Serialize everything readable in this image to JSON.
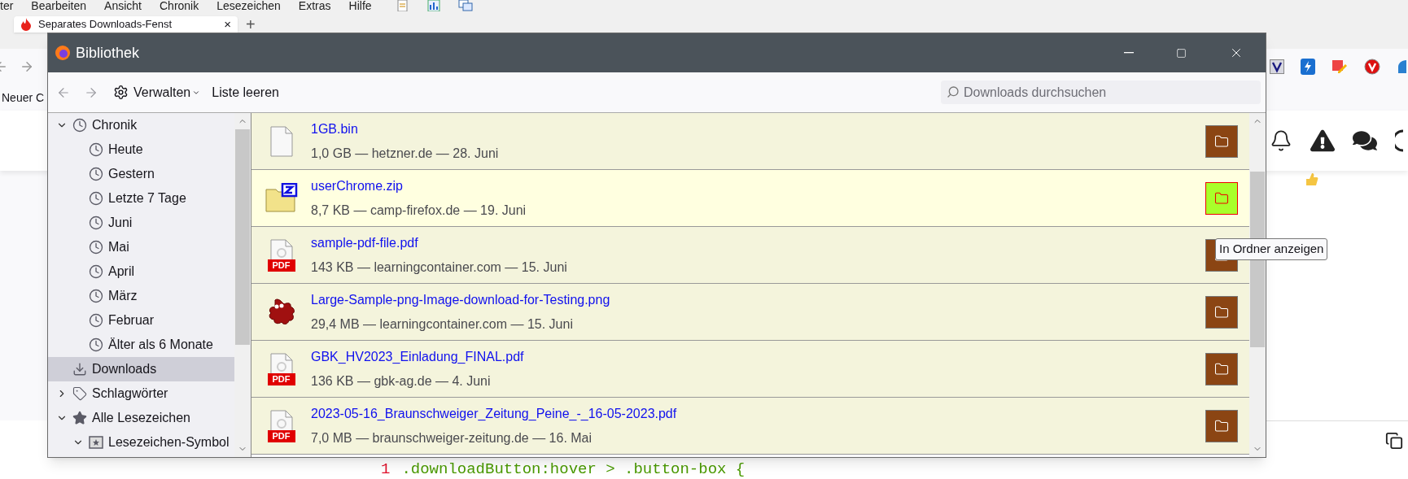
{
  "browser": {
    "menu": [
      "ter",
      "Bearbeiten",
      "Ansicht",
      "Chronik",
      "Lesezeichen",
      "Extras",
      "Hilfe"
    ],
    "tab": {
      "title": "Separates Downloads-Fenst",
      "close": "×"
    },
    "new_tab": "+",
    "bookmark": "Neuer C",
    "code_line": {
      "number": "1",
      "code": ".downloadButton:hover > .button-box {"
    }
  },
  "window": {
    "title": "Bibliothek"
  },
  "toolbar": {
    "manage": "Verwalten",
    "clear": "Liste leeren",
    "search": {
      "placeholder": "Downloads durchsuchen"
    }
  },
  "sidebar": {
    "items": [
      {
        "label": "Chronik",
        "kind": "clock",
        "expanded": true,
        "selected": false,
        "children": [
          {
            "label": "Heute",
            "kind": "clock",
            "selected": false
          },
          {
            "label": "Gestern",
            "kind": "clock",
            "selected": false
          },
          {
            "label": "Letzte 7 Tage",
            "kind": "clock",
            "selected": false
          },
          {
            "label": "Juni",
            "kind": "clock",
            "selected": false
          },
          {
            "label": "Mai",
            "kind": "clock",
            "selected": false
          },
          {
            "label": "April",
            "kind": "clock",
            "selected": false
          },
          {
            "label": "März",
            "kind": "clock",
            "selected": false
          },
          {
            "label": "Februar",
            "kind": "clock",
            "selected": false
          },
          {
            "label": "Älter als 6 Monate",
            "kind": "clock",
            "selected": false
          }
        ]
      },
      {
        "label": "Downloads",
        "kind": "download",
        "selected": true
      },
      {
        "label": "Schlagwörter",
        "kind": "tag",
        "expanded": false,
        "selected": false
      },
      {
        "label": "Alle Lesezeichen",
        "kind": "star",
        "expanded": true,
        "selected": false,
        "children": [
          {
            "label": "Lesezeichen-Symbol",
            "kind": "bookmark-folder",
            "expanded": true,
            "selected": false
          }
        ]
      }
    ]
  },
  "downloads": [
    {
      "name": "1GB.bin",
      "details": "1,0 GB — hetzner.de — 28. Juni",
      "kind": "file",
      "selected": false
    },
    {
      "name": "userChrome.zip",
      "details": "8,7 KB — camp-firefox.de — 19. Juni",
      "kind": "zip",
      "selected": true
    },
    {
      "name": "sample-pdf-file.pdf",
      "details": "143 KB — learningcontainer.com — 15. Juni",
      "kind": "pdf",
      "badge": "PDF",
      "selected": false
    },
    {
      "name": "Large-Sample-png-Image-download-for-Testing.png",
      "details": "29,4 MB — learningcontainer.com — 15. Juni",
      "kind": "image",
      "selected": false
    },
    {
      "name": "GBK_HV2023_Einladung_FINAL.pdf",
      "details": "136 KB — gbk-ag.de — 4. Juni",
      "kind": "pdf",
      "badge": "PDF",
      "selected": false
    },
    {
      "name": "2023-05-16_Braunschweiger_Zeitung_Peine_-_16-05-2023.pdf",
      "details": "7,0 MB — braunschweiger-zeitung.de — 16. Mai",
      "kind": "pdf",
      "badge": "PDF",
      "selected": false
    }
  ],
  "tooltip": "In Ordner anzeigen"
}
